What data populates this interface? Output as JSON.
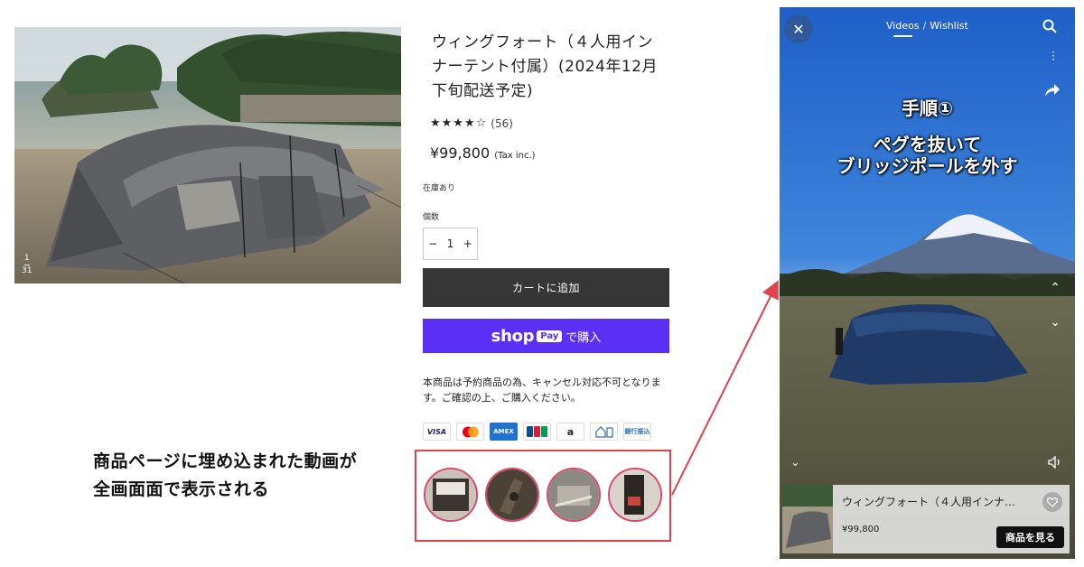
{
  "product": {
    "title": "ウィングフォート（４人用インナーテント付属）(2024年12月下旬配送予定)",
    "stars": "★★★★☆",
    "review_count": "(56)",
    "rating": 4.5,
    "price": "¥99,800",
    "tax_note": "(Tax inc.)",
    "stock": "在庫あり",
    "quantity_label": "個数",
    "quantity_minus": "−",
    "quantity_value": "1",
    "quantity_plus": "+",
    "add_to_cart": "カートに追加",
    "shop_pay_logo": "shop",
    "shop_pay_badge": "Pay",
    "shop_pay_suffix": "で購入",
    "notice": "本商品は予約商品の為、キャンセル対応不可となります。ご確認の上、ご購入ください。",
    "image_counter_current": "1",
    "image_counter_total": "31"
  },
  "payments": {
    "visa": "VISA",
    "amex": "AMEX",
    "amazon": "a",
    "furikomi": "銀行振込"
  },
  "caption": {
    "line1": "商品ページに埋め込まれた動画が",
    "line2": "全画面面で表示される"
  },
  "video_player": {
    "close": "✕",
    "tab_videos": "Videos",
    "tab_separator": "/",
    "tab_wishlist": "Wishlist",
    "overlay_line1": "手順①",
    "overlay_line2a": "ペグを抜いて",
    "overlay_line2b": "ブリッジポールを外す",
    "card_title": "ウィングフォート（４人用インナ…",
    "card_price": "¥99,800",
    "card_button": "商品を見る"
  },
  "colors": {
    "add_to_cart_bg": "#363636",
    "shop_pay": "#5a31f4",
    "highlight_red": "#e0424e"
  }
}
